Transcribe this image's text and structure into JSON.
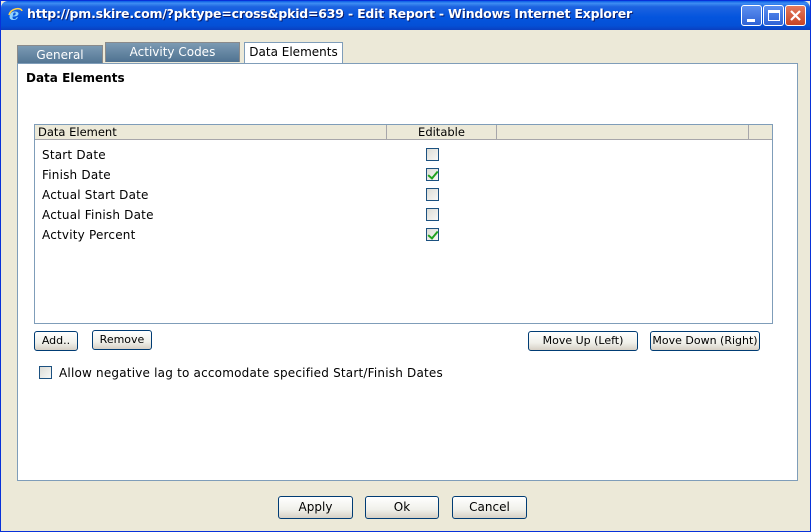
{
  "window": {
    "title": "http://pm.skire.com/?pktype=cross&pkid=639 - Edit Report - Windows Internet Explorer",
    "icon": "ie-icon"
  },
  "tabs": [
    {
      "label": "General",
      "active": false
    },
    {
      "label": "Activity Codes",
      "active": false
    },
    {
      "label": "Data Elements",
      "active": true
    }
  ],
  "panel": {
    "title": "Data Elements"
  },
  "grid": {
    "columns": [
      "Data Element",
      "Editable",
      "",
      ""
    ],
    "rows": [
      {
        "label": "Start Date",
        "editable": false
      },
      {
        "label": "Finish Date",
        "editable": true
      },
      {
        "label": "Actual Start Date",
        "editable": false
      },
      {
        "label": "Actual Finish Date",
        "editable": false
      },
      {
        "label": "Actvity Percent",
        "editable": true
      }
    ]
  },
  "buttons": {
    "add": "Add..",
    "remove": "Remove",
    "move_up": "Move Up (Left)",
    "move_down": "Move Down (Right)"
  },
  "options": {
    "negative_lag_label": "Allow negative lag to accomodate specified Start/Finish Dates",
    "negative_lag_checked": false
  },
  "footer": {
    "apply": "Apply",
    "ok": "Ok",
    "cancel": "Cancel"
  },
  "colors": {
    "titlebar": "#0455de",
    "dialog_bg": "#ece9d8",
    "tab_inactive": "#5c7e99",
    "check_mark": "#21a121"
  }
}
